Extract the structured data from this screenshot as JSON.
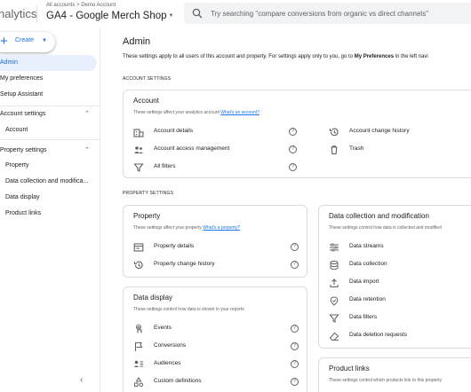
{
  "header": {
    "product_name": "nalytics",
    "breadcrumb": "All accounts > Demo Account",
    "property_name": "GA4 - Google Merch Shop",
    "search_placeholder": "Try searching \"compare conversions from organic vs direct channels\""
  },
  "sidebar": {
    "create_label": "Create",
    "items": {
      "admin": "Admin",
      "my_preferences": "My preferences",
      "setup_assistant": "Setup Assistant",
      "account_settings": "Account settings",
      "account": "Account",
      "property_settings": "Property settings",
      "property": "Property",
      "data_collection": "Data collection and modifica...",
      "data_display": "Data display",
      "product_links": "Product links"
    }
  },
  "main": {
    "title": "Admin",
    "description_prefix": "These settings apply to all users of this account and property. For settings apply only to you, go to ",
    "description_link": "My Preferences",
    "description_suffix": " in the left navi",
    "account_settings_heading": "ACCOUNT SETTINGS",
    "property_settings_heading": "PROPERTY SETTINGS",
    "account_card": {
      "title": "Account",
      "subtitle": "These settings affect your analytics account",
      "link": "What's an account?",
      "left_items": [
        "Account details",
        "Account access management",
        "All filters"
      ],
      "right_items": [
        "Account change history",
        "Trash"
      ]
    },
    "property_card": {
      "title": "Property",
      "subtitle": "These settings affect your property",
      "link": "What's a property?",
      "items": [
        "Property details",
        "Property change history"
      ]
    },
    "data_collection_card": {
      "title": "Data collection and modification",
      "subtitle": "These settings control how data is collected and modified",
      "items": [
        "Data streams",
        "Data collection",
        "Data import",
        "Data retention",
        "Data filters",
        "Data deletion requests"
      ]
    },
    "data_display_card": {
      "title": "Data display",
      "subtitle": "These settings control how data is shown in your reports",
      "items": [
        "Events",
        "Conversions",
        "Audiences",
        "Custom definitions"
      ]
    },
    "product_links_card": {
      "title": "Product links",
      "subtitle": "These settings control which products link to this property"
    }
  },
  "colors": {
    "accent": "#1a73e8",
    "active_nav_bg": "#e8f0fe",
    "border": "#dadce0",
    "text": "#202124",
    "muted": "#5f6368"
  }
}
